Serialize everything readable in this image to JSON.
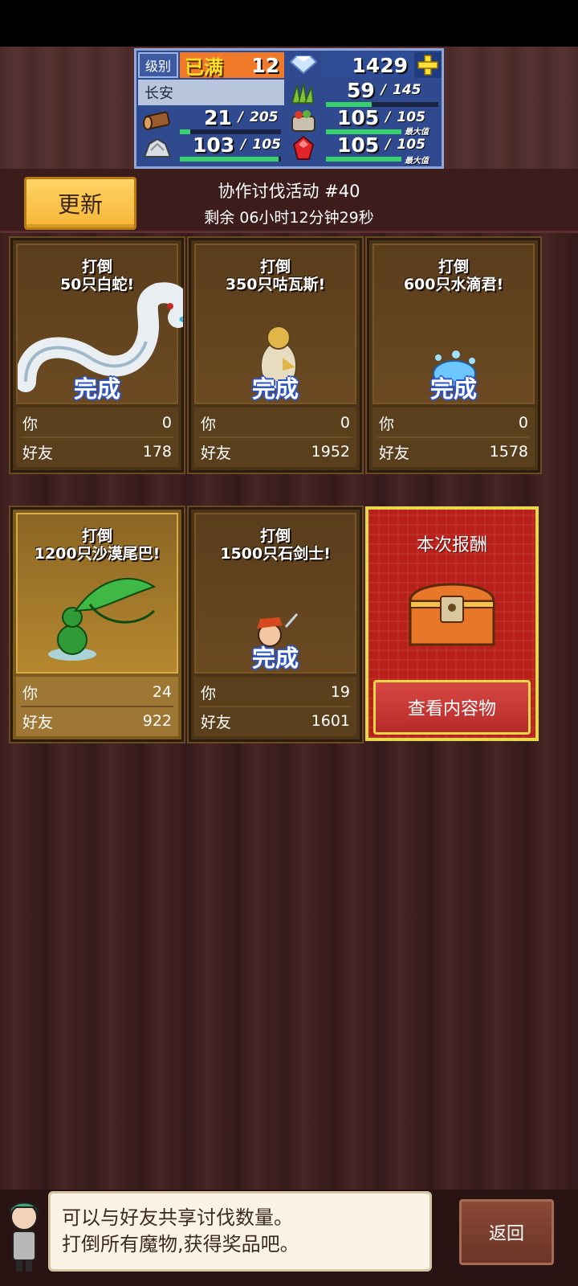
{
  "hud": {
    "level_label": "级别",
    "level_status": "已满",
    "level_value": "12",
    "gems": "1429",
    "location": "长安",
    "grass_current": "59",
    "grass_max": "145",
    "grass_fill": 0.41,
    "wood_current": "21",
    "wood_max": "205",
    "wood_fill": 0.1,
    "food_current": "105",
    "food_max": "105",
    "food_fill": 1.0,
    "food_max_tag": "最大值",
    "ore_current": "103",
    "ore_max": "105",
    "ore_fill": 0.98,
    "ruby_current": "105",
    "ruby_max": "105",
    "ruby_fill": 1.0,
    "ruby_max_tag": "最大值",
    "slash": "/"
  },
  "header": {
    "update_label": "更新",
    "event_title": "协作讨伐活动 #40",
    "event_timer": "剩余 06小时12分钟29秒"
  },
  "cards": [
    {
      "line1": "打倒",
      "line2": "50只白蛇!",
      "done": "完成",
      "you_label": "你",
      "you": "0",
      "friends_label": "好友",
      "friends": "178"
    },
    {
      "line1": "打倒",
      "line2": "350只咕瓦斯!",
      "done": "完成",
      "you_label": "你",
      "you": "0",
      "friends_label": "好友",
      "friends": "1952"
    },
    {
      "line1": "打倒",
      "line2": "600只水滴君!",
      "done": "完成",
      "you_label": "你",
      "you": "0",
      "friends_label": "好友",
      "friends": "1578"
    },
    {
      "line1": "打倒",
      "line2": "1200只沙漠尾巴!",
      "done": "",
      "you_label": "你",
      "you": "24",
      "friends_label": "好友",
      "friends": "922"
    },
    {
      "line1": "打倒",
      "line2": "1500只石剑士!",
      "done": "完成",
      "you_label": "你",
      "you": "19",
      "friends_label": "好友",
      "friends": "1601"
    }
  ],
  "reward": {
    "title": "本次报酬",
    "button": "查看内容物"
  },
  "dialog": {
    "line1": "可以与好友共享讨伐数量。",
    "line2": "打倒所有魔物,获得奖品吧。"
  },
  "back_label": "返回",
  "colors": {
    "hud_bg": "#2f4a8e",
    "bar_green": "#37d26a",
    "update_button": "#f5b536",
    "reward_red": "#b9201a",
    "reward_border": "#e9d84a",
    "done_blue": "#2e56c9"
  },
  "icons": [
    "diamond-icon",
    "plus-icon",
    "grass-icon",
    "wood-icon",
    "food-icon",
    "ore-icon",
    "ruby-icon",
    "treasure-chest-icon"
  ]
}
